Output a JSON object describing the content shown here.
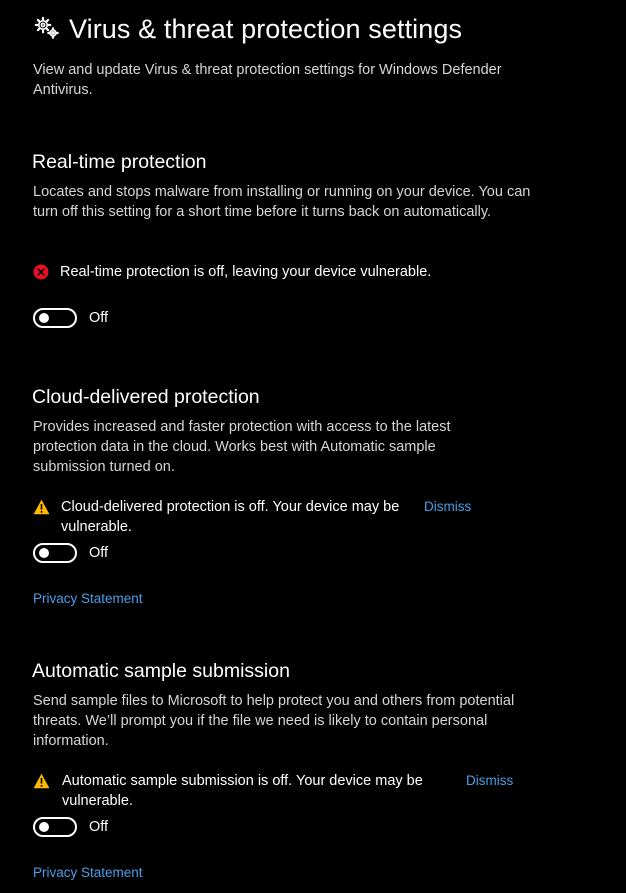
{
  "header": {
    "title": "Virus & threat protection settings",
    "subtitle": "View and update Virus & threat protection settings for Windows Defender Antivirus.",
    "icon": "gear-icon"
  },
  "colors": {
    "background": "#000000",
    "link": "#4a9fe8",
    "error": "#e81123",
    "warning": "#ffb900"
  },
  "realtime": {
    "heading": "Real-time protection",
    "description": "Locates and stops malware from installing or running on your device. You can turn off this setting for a short time before it turns back on automatically.",
    "alert_text": "Real-time protection is off, leaving your device vulnerable.",
    "alert_icon": "error-icon",
    "toggle_label": "Off",
    "toggle_on": false
  },
  "cloud": {
    "heading": "Cloud-delivered protection",
    "description": "Provides increased and faster protection with access to the latest protection data in the cloud.  Works best with Automatic sample submission turned on.",
    "alert_text": "Cloud-delivered protection is off. Your device may be vulnerable.",
    "alert_icon": "warning-icon",
    "dismiss_label": "Dismiss",
    "toggle_label": "Off",
    "toggle_on": false,
    "privacy_label": "Privacy Statement"
  },
  "sample": {
    "heading": "Automatic sample submission",
    "description": "Send sample files to Microsoft to help protect you and others from potential threats.  We’ll prompt you if the file we need is likely to contain personal information.",
    "alert_text": "Automatic sample submission is off. Your device may be vulnerable.",
    "alert_icon": "warning-icon",
    "dismiss_label": "Dismiss",
    "toggle_label": "Off",
    "toggle_on": false,
    "privacy_label": "Privacy Statement"
  }
}
